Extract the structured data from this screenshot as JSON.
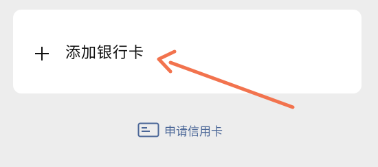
{
  "add_card": {
    "label": "添加银行卡",
    "icon": "plus-icon"
  },
  "apply_link": {
    "label": "申请信用卡",
    "icon": "credit-card-icon",
    "color": "#4a6697"
  },
  "annotation": {
    "arrow_color": "#f2734e"
  }
}
